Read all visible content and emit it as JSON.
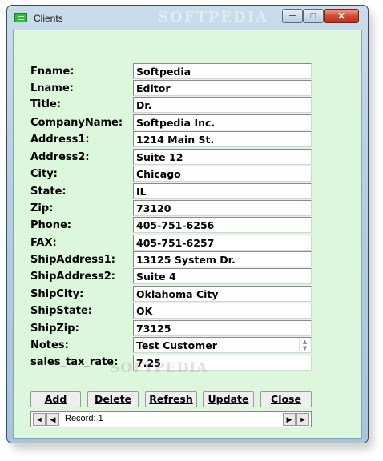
{
  "window": {
    "title": "Clients",
    "watermark": "SOFTPEDIA",
    "minimize_icon": "minimize-icon",
    "maximize_icon": "maximize-icon",
    "close_icon": "close-icon"
  },
  "fields": [
    {
      "label": "Fname:",
      "value": "Softpedia"
    },
    {
      "label": "Lname:",
      "value": "Editor"
    },
    {
      "label": "Title:",
      "value": "Dr."
    },
    {
      "label": "CompanyName:",
      "value": "Softpedia Inc."
    },
    {
      "label": "Address1:",
      "value": "1214 Main St."
    },
    {
      "label": "Address2:",
      "value": "Suite 12"
    },
    {
      "label": "City:",
      "value": "Chicago"
    },
    {
      "label": "State:",
      "value": "IL"
    },
    {
      "label": "Zip:",
      "value": "73120"
    },
    {
      "label": "Phone:",
      "value": "405-751-6256"
    },
    {
      "label": "FAX:",
      "value": "405-751-6257"
    },
    {
      "label": "ShipAddress1:",
      "value": "13125 System Dr."
    },
    {
      "label": "ShipAddress2:",
      "value": "Suite 4"
    },
    {
      "label": "ShipCity:",
      "value": "Oklahoma City"
    },
    {
      "label": "ShipState:",
      "value": "OK"
    },
    {
      "label": "ShipZip:",
      "value": "73125"
    },
    {
      "label": "Notes:",
      "value": "Test Customer"
    },
    {
      "label": "sales_tax_rate:",
      "value": "7.25"
    }
  ],
  "buttons": {
    "add": "Add",
    "delete": "Delete",
    "refresh": "Refresh",
    "update": "Update",
    "close": "Close"
  },
  "navigator": {
    "record_text": "Record: 1"
  }
}
